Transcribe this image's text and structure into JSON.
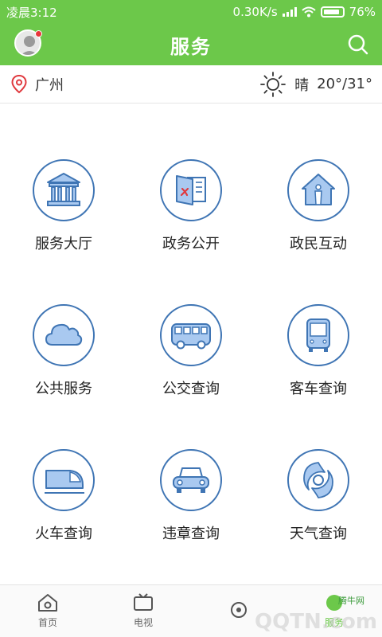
{
  "status": {
    "time": "凌晨3:12",
    "net_speed": "0.30K/s",
    "battery": "76%"
  },
  "header": {
    "title": "服务"
  },
  "location": {
    "city": "广州",
    "weather": "晴",
    "temperature": "20°/31°"
  },
  "services": [
    {
      "label": "服务大厅",
      "icon": "government-hall-icon"
    },
    {
      "label": "政务公开",
      "icon": "public-affairs-icon"
    },
    {
      "label": "政民互动",
      "icon": "citizen-interaction-icon"
    },
    {
      "label": "公共服务",
      "icon": "cloud-icon"
    },
    {
      "label": "公交查询",
      "icon": "bus-icon"
    },
    {
      "label": "客车查询",
      "icon": "coach-icon"
    },
    {
      "label": "火车查询",
      "icon": "train-icon"
    },
    {
      "label": "违章查询",
      "icon": "car-icon"
    },
    {
      "label": "天气查询",
      "icon": "typhoon-icon"
    }
  ],
  "tabbar": [
    {
      "label": "首页",
      "icon": "home-icon"
    },
    {
      "label": "电视",
      "icon": "tv-icon"
    },
    {
      "label": "",
      "icon": "radio-icon"
    },
    {
      "label": "服务",
      "icon": "service-icon"
    }
  ],
  "watermark": {
    "main": "QQTN.com",
    "small": "腾牛网"
  },
  "colors": {
    "brand_green": "#6cc84a",
    "icon_blue": "#3f75b4",
    "icon_fill": "#a9c9f0"
  }
}
